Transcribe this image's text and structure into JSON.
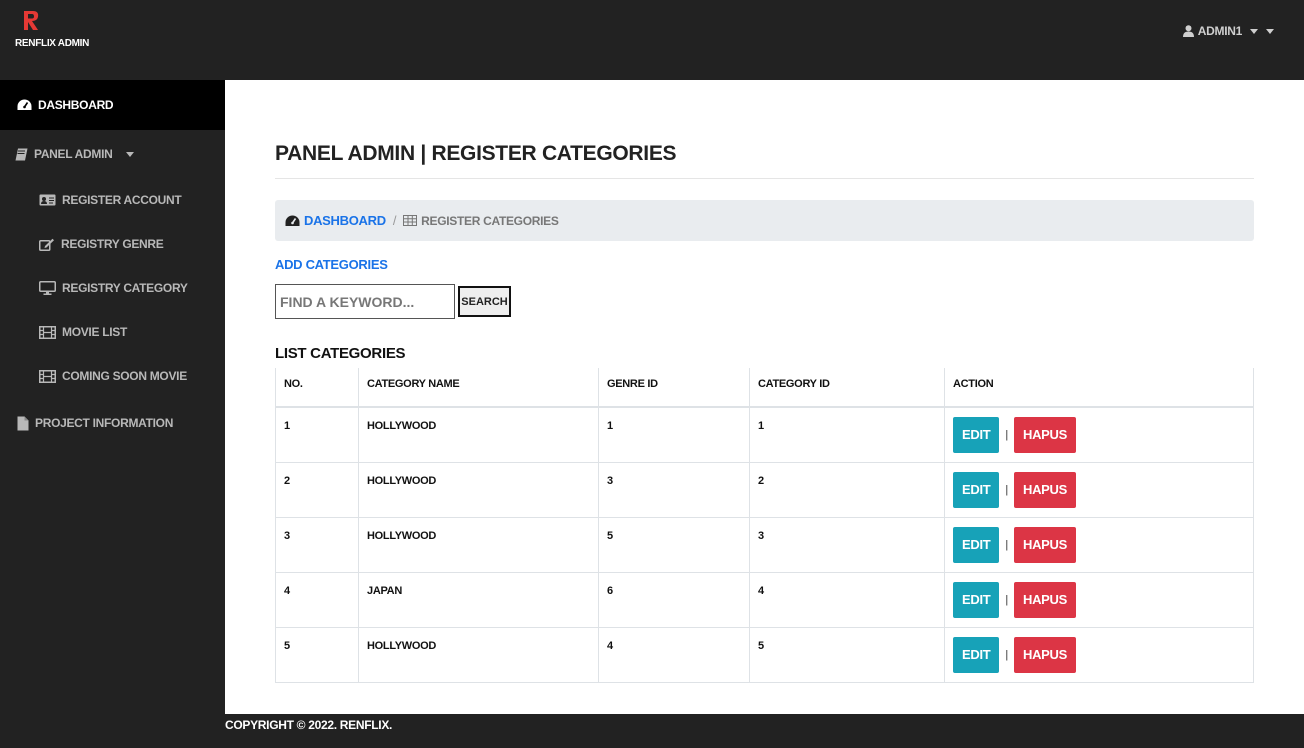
{
  "brand": {
    "name": "RENFLIX ADMIN",
    "accent": "#e53935"
  },
  "user": {
    "name": "ADMIN1"
  },
  "sidebar": {
    "dashboard": "DASHBOARD",
    "panel_admin": "PANEL ADMIN",
    "sub_items": [
      {
        "label": "REGISTER ACCOUNT",
        "icon": "id-card-icon"
      },
      {
        "label": "REGISTRY GENRE",
        "icon": "edit-icon"
      },
      {
        "label": "REGISTRY CATEGORY",
        "icon": "desktop-icon"
      },
      {
        "label": "MOVIE LIST",
        "icon": "film-icon"
      },
      {
        "label": "COMING SOON MOVIE",
        "icon": "film-icon"
      }
    ],
    "project_info": "PROJECT INFORMATION"
  },
  "main": {
    "title": "PANEL ADMIN | REGISTER CATEGORIES",
    "breadcrumb": {
      "home": "DASHBOARD",
      "current": "REGISTER CATEGORIES"
    },
    "add_link": "ADD CATEGORIES",
    "search": {
      "placeholder": "FIND A KEYWORD...",
      "button": "SEARCH"
    },
    "list_title": "LIST CATEGORIES",
    "table": {
      "headers": [
        "NO.",
        "CATEGORY NAME",
        "GENRE ID",
        "CATEGORY ID",
        "ACTION"
      ],
      "rows": [
        {
          "no": "1",
          "name": "HOLLYWOOD",
          "genre_id": "1",
          "category_id": "1"
        },
        {
          "no": "2",
          "name": "HOLLYWOOD",
          "genre_id": "3",
          "category_id": "2"
        },
        {
          "no": "3",
          "name": "HOLLYWOOD",
          "genre_id": "5",
          "category_id": "3"
        },
        {
          "no": "4",
          "name": "JAPAN",
          "genre_id": "6",
          "category_id": "4"
        },
        {
          "no": "5",
          "name": "HOLLYWOOD",
          "genre_id": "4",
          "category_id": "5"
        }
      ],
      "edit_label": "EDIT",
      "separator": "|",
      "delete_label": "HAPUS"
    }
  },
  "footer": {
    "text": "COPYRIGHT © 2022. RENFLIX."
  },
  "colors": {
    "edit": "#17a2b8",
    "delete": "#dc3545",
    "link": "#1a73e8",
    "dark": "#222222"
  }
}
